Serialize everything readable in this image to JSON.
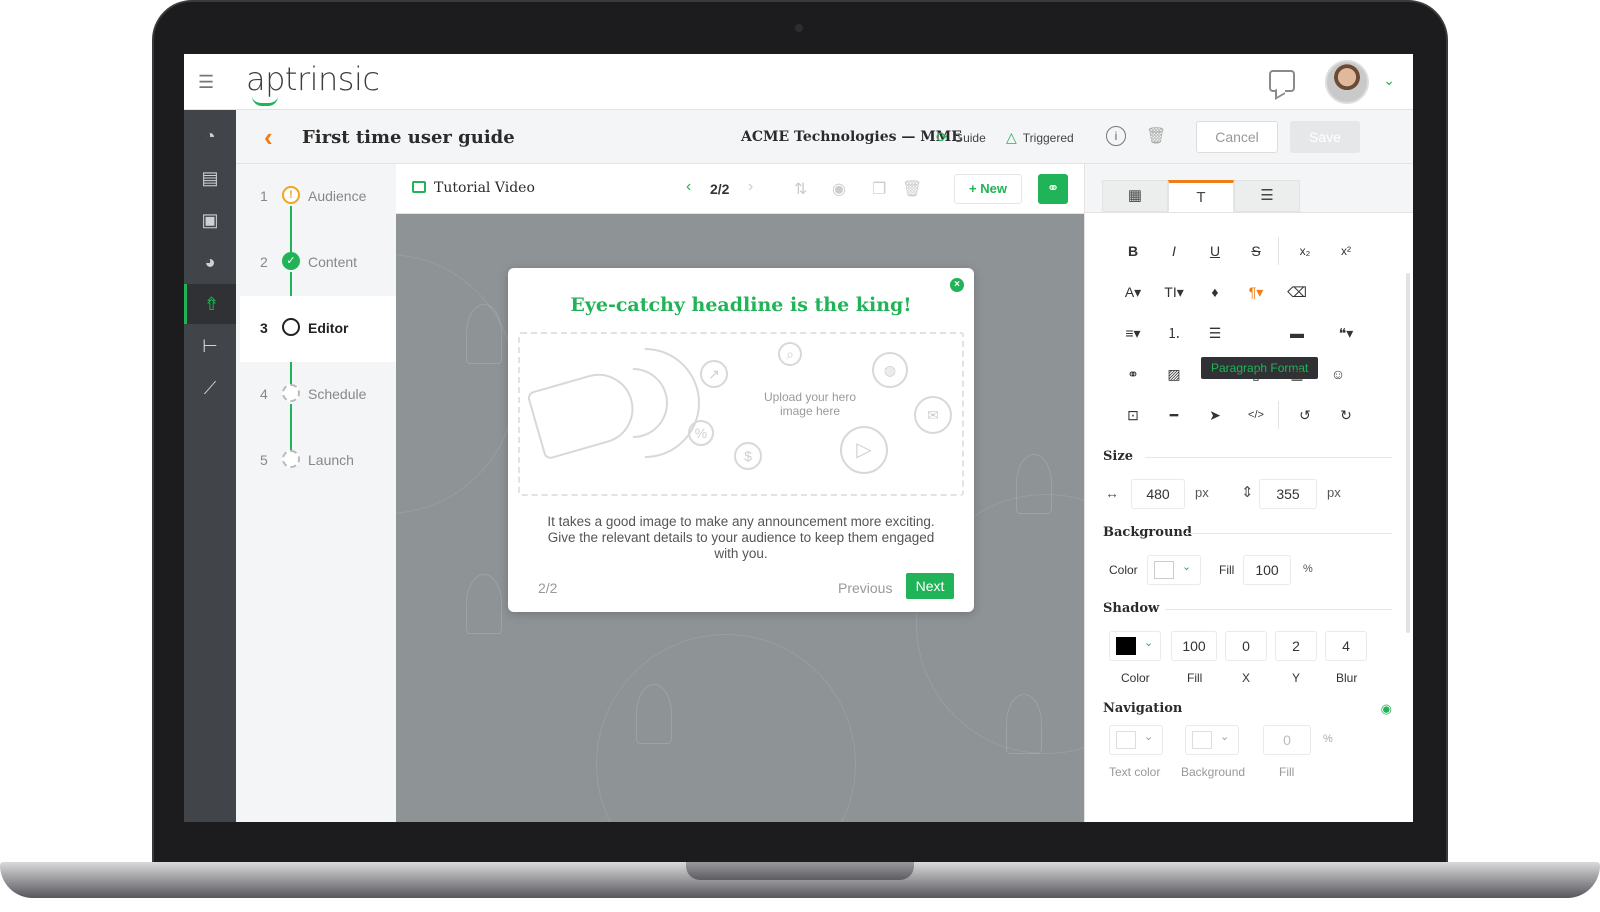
{
  "app": {
    "logo": "aptrinsic"
  },
  "header": {
    "title": "First time user guide",
    "company": "ACME Technologies — MME",
    "guide_label": "Guide",
    "triggered_label": "Triggered",
    "cancel_label": "Cancel",
    "save_label": "Save"
  },
  "nav": {
    "items": [
      "speedometer-icon",
      "users-card-icon",
      "briefcase-icon",
      "pie-chart-icon",
      "rocket-icon",
      "tree-icon",
      "line-chart-icon"
    ],
    "active": "rocket-icon"
  },
  "steps": [
    {
      "num": "1",
      "label": "Audience",
      "state": "warning"
    },
    {
      "num": "2",
      "label": "Content",
      "state": "done"
    },
    {
      "num": "3",
      "label": "Editor",
      "state": "current"
    },
    {
      "num": "4",
      "label": "Schedule",
      "state": "pending"
    },
    {
      "num": "5",
      "label": "Launch",
      "state": "pending"
    }
  ],
  "editor": {
    "slide_title": "Tutorial Video",
    "pager": "2/2",
    "new_label": "+ New"
  },
  "modal": {
    "headline": "Eye-catchy headline is the king!",
    "hero_text": "Upload your hero image here",
    "body": "It takes a good image to make any announcement more exciting. Give the relevant details to your audience to keep them engaged with you.",
    "page": "2/2",
    "previous_label": "Previous",
    "next_label": "Next"
  },
  "panel": {
    "tooltip": "Paragraph Format",
    "size": {
      "title": "Size",
      "width": "480",
      "height": "355",
      "unit": "px"
    },
    "background": {
      "title": "Background",
      "color_label": "Color",
      "fill_label": "Fill",
      "fill": "100",
      "unit": "%"
    },
    "shadow": {
      "title": "Shadow",
      "fill": "100",
      "x": "0",
      "y": "2",
      "blur": "4",
      "labels": {
        "color": "Color",
        "fill": "Fill",
        "x": "X",
        "y": "Y",
        "blur": "Blur"
      }
    },
    "navigation": {
      "title": "Navigation",
      "fill": "0",
      "unit": "%",
      "labels": {
        "text_color": "Text color",
        "background": "Background",
        "fill": "Fill"
      }
    }
  },
  "colors": {
    "accent": "#21b357",
    "orange": "#f07d1a",
    "nav_bg": "#414448",
    "canvas_bg": "#8e9396"
  }
}
